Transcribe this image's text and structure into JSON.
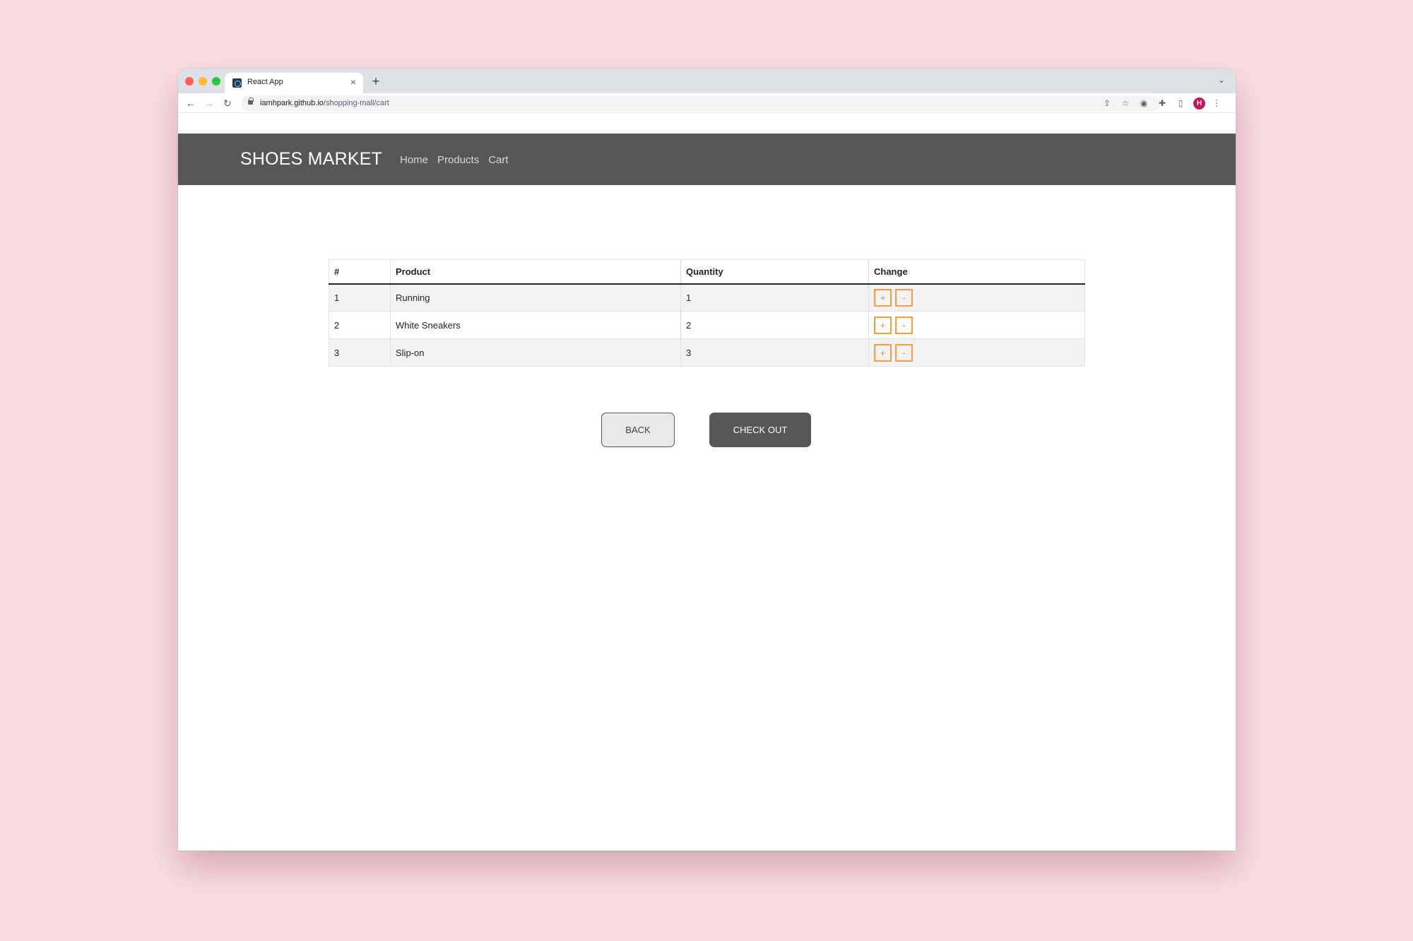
{
  "browser": {
    "tab_title": "React App",
    "tab_close": "×",
    "new_tab": "+",
    "tab_list": "⌄",
    "url_host": "iamhpark.github.io",
    "url_path": "/shopping-mall/cart",
    "nav_back": "←",
    "nav_forward": "→",
    "nav_reload": "↻",
    "share": "⇪",
    "star": "☆",
    "extension": "◉",
    "puzzle": "✚",
    "side_panel": "▯",
    "profile_initial": "H",
    "menu": "⋮"
  },
  "navbar": {
    "brand": "SHOES MARKET",
    "links": [
      "Home",
      "Products",
      "Cart"
    ]
  },
  "cart": {
    "headers": [
      "#",
      "Product",
      "Quantity",
      "Change"
    ],
    "rows": [
      {
        "num": "1",
        "product": "Running",
        "quantity": "1"
      },
      {
        "num": "2",
        "product": "White Sneakers",
        "quantity": "2"
      },
      {
        "num": "3",
        "product": "Slip-on",
        "quantity": "3"
      }
    ],
    "increase_label": "+",
    "decrease_label": "-"
  },
  "actions": {
    "back": "BACK",
    "checkout": "CHECK OUT"
  },
  "colors": {
    "page_background": "#fcdde1",
    "navbar": "#575757",
    "accent_orange": "#ff9a3d"
  }
}
